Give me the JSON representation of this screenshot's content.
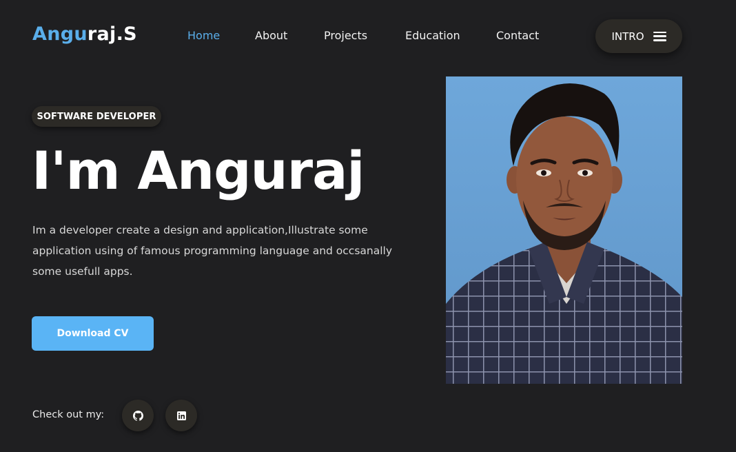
{
  "header": {
    "logo_primary": "Angu",
    "logo_secondary": "raj.S",
    "nav": [
      {
        "label": "Home",
        "active": true
      },
      {
        "label": "About",
        "active": false
      },
      {
        "label": "Projects",
        "active": false
      },
      {
        "label": "Education",
        "active": false
      },
      {
        "label": "Contact",
        "active": false
      }
    ],
    "intro_button": "INTRO",
    "intro_icon": "menu-icon"
  },
  "hero": {
    "badge": "SOFTWARE DEVELOPER",
    "title": "I'm Anguraj",
    "description": "Im a developer create a design and application,Illustrate some application using of famous programming language and occsanally some usefull apps.",
    "cv_button": "Download CV",
    "social_label": "Check out my:",
    "social": [
      {
        "icon": "github-icon"
      },
      {
        "icon": "linkedin-icon"
      }
    ]
  },
  "colors": {
    "background": "#1f1f21",
    "accent": "#5aaeea",
    "button": "#5ab4f5",
    "pill": "#2c2a26"
  }
}
